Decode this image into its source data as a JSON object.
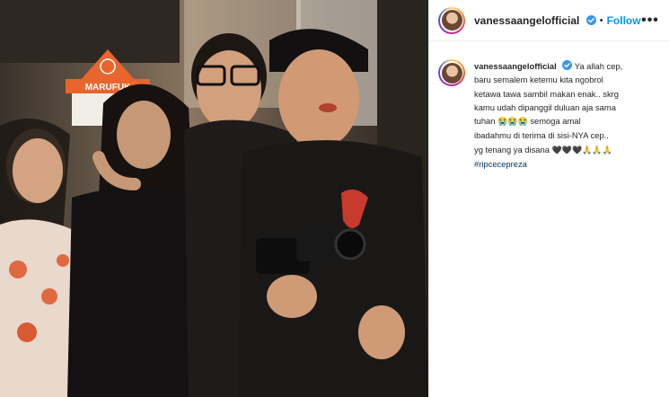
{
  "post": {
    "username": "vanessaangelofficial",
    "verified": true,
    "follow_label": "Follow",
    "separator": "•",
    "more_label": "•••"
  },
  "caption": {
    "username": "vanessaangelofficial",
    "line1": "Ya allah cep,",
    "line2": "baru semalem ketemu kita ngobrol",
    "line3": "ketawa tawa sambil makan enak.. skrg",
    "line4": "kamu udah dipanggil duluan aja sama",
    "line5a": "tuhan",
    "line5_emoji": "😭😭😭",
    "line5b": "semoga amal",
    "line6": "ibadahmu di terima di sisi-NYA cep..",
    "line7a": "yg tenang ya disana",
    "line7_emoji": "🖤🖤🖤🙏🙏🙏",
    "hashtag": "#ripcecepreza"
  },
  "photo": {
    "sign_text": "MARUFUK"
  },
  "colors": {
    "accent": "#0095f6",
    "hashtag": "#00376b",
    "verified": "#3897f0"
  }
}
